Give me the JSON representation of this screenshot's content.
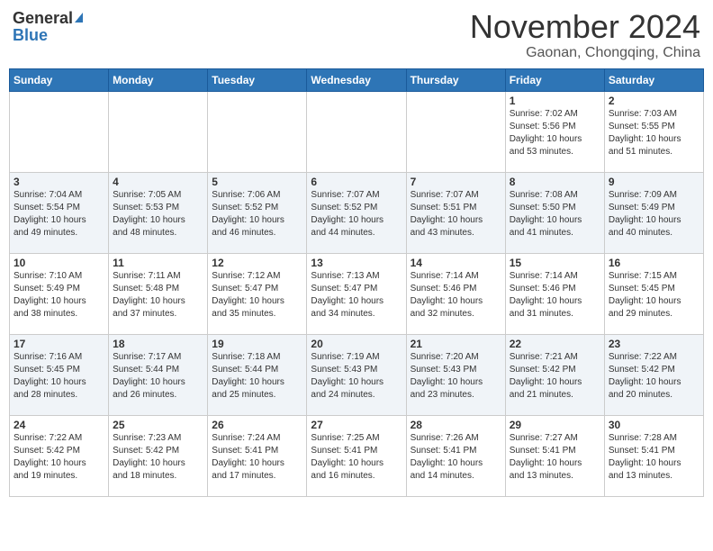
{
  "header": {
    "logo_line1": "General",
    "logo_line2": "Blue",
    "month_title": "November 2024",
    "location": "Gaonan, Chongqing, China"
  },
  "weekdays": [
    "Sunday",
    "Monday",
    "Tuesday",
    "Wednesday",
    "Thursday",
    "Friday",
    "Saturday"
  ],
  "weeks": [
    [
      {
        "day": "",
        "text": ""
      },
      {
        "day": "",
        "text": ""
      },
      {
        "day": "",
        "text": ""
      },
      {
        "day": "",
        "text": ""
      },
      {
        "day": "",
        "text": ""
      },
      {
        "day": "1",
        "text": "Sunrise: 7:02 AM\nSunset: 5:56 PM\nDaylight: 10 hours\nand 53 minutes."
      },
      {
        "day": "2",
        "text": "Sunrise: 7:03 AM\nSunset: 5:55 PM\nDaylight: 10 hours\nand 51 minutes."
      }
    ],
    [
      {
        "day": "3",
        "text": "Sunrise: 7:04 AM\nSunset: 5:54 PM\nDaylight: 10 hours\nand 49 minutes."
      },
      {
        "day": "4",
        "text": "Sunrise: 7:05 AM\nSunset: 5:53 PM\nDaylight: 10 hours\nand 48 minutes."
      },
      {
        "day": "5",
        "text": "Sunrise: 7:06 AM\nSunset: 5:52 PM\nDaylight: 10 hours\nand 46 minutes."
      },
      {
        "day": "6",
        "text": "Sunrise: 7:07 AM\nSunset: 5:52 PM\nDaylight: 10 hours\nand 44 minutes."
      },
      {
        "day": "7",
        "text": "Sunrise: 7:07 AM\nSunset: 5:51 PM\nDaylight: 10 hours\nand 43 minutes."
      },
      {
        "day": "8",
        "text": "Sunrise: 7:08 AM\nSunset: 5:50 PM\nDaylight: 10 hours\nand 41 minutes."
      },
      {
        "day": "9",
        "text": "Sunrise: 7:09 AM\nSunset: 5:49 PM\nDaylight: 10 hours\nand 40 minutes."
      }
    ],
    [
      {
        "day": "10",
        "text": "Sunrise: 7:10 AM\nSunset: 5:49 PM\nDaylight: 10 hours\nand 38 minutes."
      },
      {
        "day": "11",
        "text": "Sunrise: 7:11 AM\nSunset: 5:48 PM\nDaylight: 10 hours\nand 37 minutes."
      },
      {
        "day": "12",
        "text": "Sunrise: 7:12 AM\nSunset: 5:47 PM\nDaylight: 10 hours\nand 35 minutes."
      },
      {
        "day": "13",
        "text": "Sunrise: 7:13 AM\nSunset: 5:47 PM\nDaylight: 10 hours\nand 34 minutes."
      },
      {
        "day": "14",
        "text": "Sunrise: 7:14 AM\nSunset: 5:46 PM\nDaylight: 10 hours\nand 32 minutes."
      },
      {
        "day": "15",
        "text": "Sunrise: 7:14 AM\nSunset: 5:46 PM\nDaylight: 10 hours\nand 31 minutes."
      },
      {
        "day": "16",
        "text": "Sunrise: 7:15 AM\nSunset: 5:45 PM\nDaylight: 10 hours\nand 29 minutes."
      }
    ],
    [
      {
        "day": "17",
        "text": "Sunrise: 7:16 AM\nSunset: 5:45 PM\nDaylight: 10 hours\nand 28 minutes."
      },
      {
        "day": "18",
        "text": "Sunrise: 7:17 AM\nSunset: 5:44 PM\nDaylight: 10 hours\nand 26 minutes."
      },
      {
        "day": "19",
        "text": "Sunrise: 7:18 AM\nSunset: 5:44 PM\nDaylight: 10 hours\nand 25 minutes."
      },
      {
        "day": "20",
        "text": "Sunrise: 7:19 AM\nSunset: 5:43 PM\nDaylight: 10 hours\nand 24 minutes."
      },
      {
        "day": "21",
        "text": "Sunrise: 7:20 AM\nSunset: 5:43 PM\nDaylight: 10 hours\nand 23 minutes."
      },
      {
        "day": "22",
        "text": "Sunrise: 7:21 AM\nSunset: 5:42 PM\nDaylight: 10 hours\nand 21 minutes."
      },
      {
        "day": "23",
        "text": "Sunrise: 7:22 AM\nSunset: 5:42 PM\nDaylight: 10 hours\nand 20 minutes."
      }
    ],
    [
      {
        "day": "24",
        "text": "Sunrise: 7:22 AM\nSunset: 5:42 PM\nDaylight: 10 hours\nand 19 minutes."
      },
      {
        "day": "25",
        "text": "Sunrise: 7:23 AM\nSunset: 5:42 PM\nDaylight: 10 hours\nand 18 minutes."
      },
      {
        "day": "26",
        "text": "Sunrise: 7:24 AM\nSunset: 5:41 PM\nDaylight: 10 hours\nand 17 minutes."
      },
      {
        "day": "27",
        "text": "Sunrise: 7:25 AM\nSunset: 5:41 PM\nDaylight: 10 hours\nand 16 minutes."
      },
      {
        "day": "28",
        "text": "Sunrise: 7:26 AM\nSunset: 5:41 PM\nDaylight: 10 hours\nand 14 minutes."
      },
      {
        "day": "29",
        "text": "Sunrise: 7:27 AM\nSunset: 5:41 PM\nDaylight: 10 hours\nand 13 minutes."
      },
      {
        "day": "30",
        "text": "Sunrise: 7:28 AM\nSunset: 5:41 PM\nDaylight: 10 hours\nand 13 minutes."
      }
    ]
  ]
}
